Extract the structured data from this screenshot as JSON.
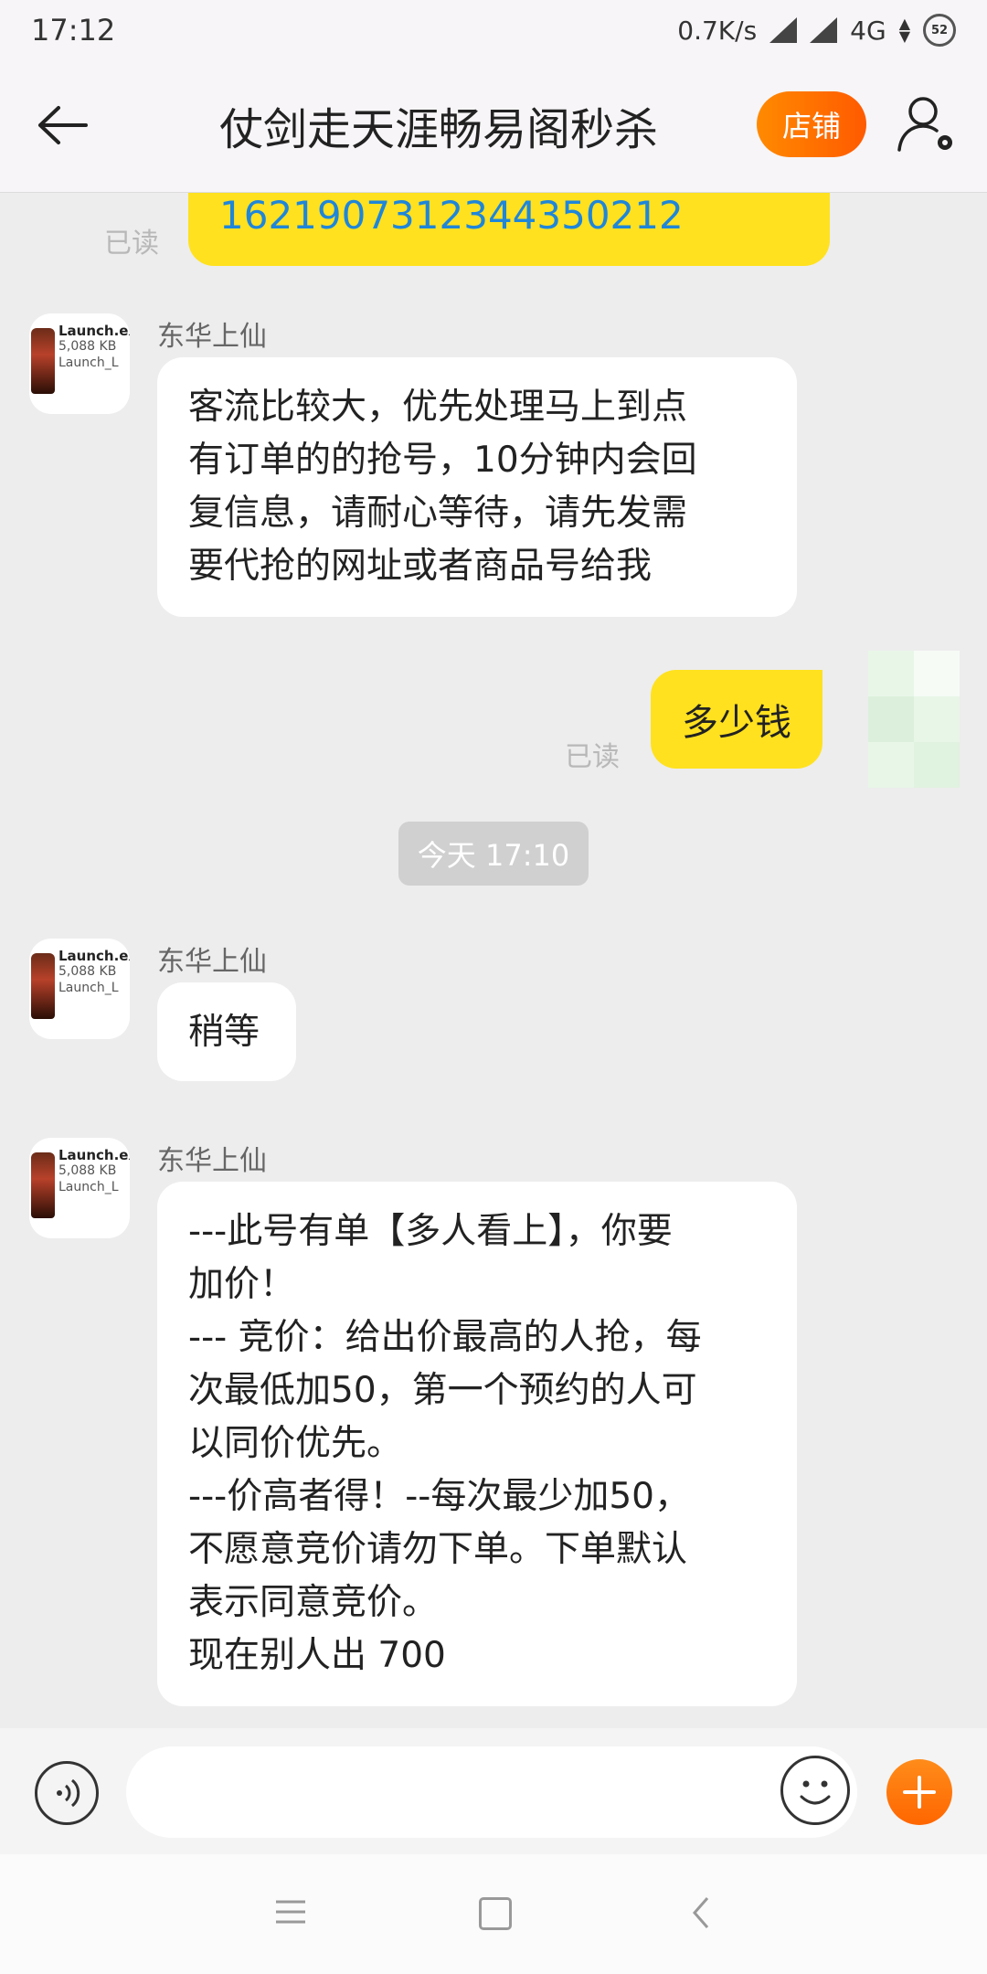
{
  "status_bar": {
    "time": "17:12",
    "net_speed": "0.7K/s",
    "network": "4G",
    "battery": "52"
  },
  "header": {
    "title": "仗剑走天涯畅易阁秒杀",
    "shop_button": "店铺"
  },
  "messages": {
    "top_bubble": {
      "text": "1621907312344350212",
      "read": "已读"
    },
    "m1": {
      "sender": "东华上仙",
      "lines": [
        "客流比较大，优先处理马上到点",
        "有订单的的抢号，10分钟内会回",
        "复信息，请耐心等待，请先发需",
        "要代抢的网址或者商品号给我"
      ]
    },
    "m2": {
      "text": "多少钱",
      "read": "已读"
    },
    "timestamp": "今天  17:10",
    "m3": {
      "sender": "东华上仙",
      "text": "稍等"
    },
    "m4": {
      "sender": "东华上仙",
      "lines": [
        "---此号有单【多人看上】，你要",
        "加价！",
        "--- 竞价：给出价最高的人抢，每",
        "次最低加50，第一个预约的人可",
        "以同价优先。",
        "---价高者得！--每次最少加50，",
        "不愿意竞价请勿下单。下单默认",
        "表示同意竞价。",
        "现在别人出 700"
      ]
    }
  },
  "avatar": {
    "line1": "Launch.ex",
    "line2": "5,088 KB",
    "line3": "Launch_L"
  }
}
